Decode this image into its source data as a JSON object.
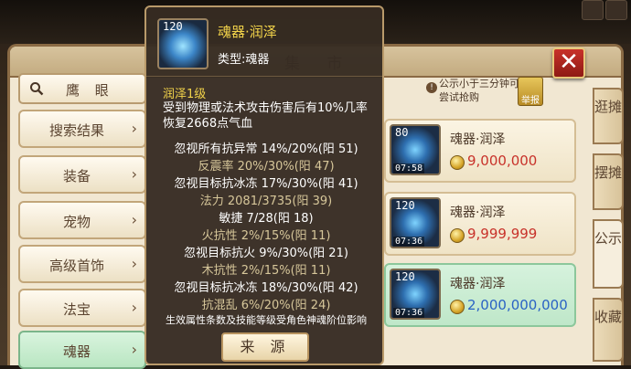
{
  "market": {
    "title": "集 市",
    "close_label": "✕"
  },
  "search": {
    "label": "鹰 眼",
    "icon": "search-icon"
  },
  "menu": [
    {
      "label": "搜索结果",
      "arrow": "›"
    },
    {
      "label": "装备",
      "arrow": "›"
    },
    {
      "label": "宠物",
      "arrow": "›"
    },
    {
      "label": "高级首饰",
      "arrow": "›"
    },
    {
      "label": "法宝",
      "arrow": "›"
    },
    {
      "label": "魂器",
      "arrow": "›"
    }
  ],
  "notice": {
    "icon": "!",
    "text": "公示小于三分钟可尝试抢购",
    "report_label": "举报"
  },
  "side_tabs": [
    {
      "label": "逛摊"
    },
    {
      "label": "摆摊"
    },
    {
      "label": "公示"
    },
    {
      "label": "收藏"
    }
  ],
  "listings": [
    {
      "level": "80",
      "time": "07:58",
      "name": "魂器·润泽",
      "price": "9,000,000",
      "price_color": "#c8322a"
    },
    {
      "level": "120",
      "time": "07:36",
      "name": "魂器·润泽",
      "price": "9,999,999",
      "price_color": "#c8322a"
    },
    {
      "level": "120",
      "time": "07:36",
      "name": "魂器·润泽",
      "price": "2,000,000,000",
      "price_color": "#2a63c4"
    }
  ],
  "tooltip": {
    "level": "120",
    "title": "魂器·润泽",
    "type": "类型:魂器",
    "skill_name": "润泽1级",
    "skill_desc": "受到物理或法术攻击伤害后有10%几率恢复2668点气血",
    "attributes": [
      {
        "text": "忽视所有抗异常 14%/20%(阳 51)",
        "color": "#ffffff"
      },
      {
        "text": "反震率 20%/30%(阳 47)",
        "color": "#d7c79a"
      },
      {
        "text": "忽视目标抗冰冻 17%/30%(阳 41)",
        "color": "#ffffff"
      },
      {
        "text": "法力 2081/3735(阳 39)",
        "color": "#d7c79a"
      },
      {
        "text": "敏捷 7/28(阳 18)",
        "color": "#ffffff"
      },
      {
        "text": "火抗性 2%/15%(阳 11)",
        "color": "#d7c79a"
      },
      {
        "text": "忽视目标抗火 9%/30%(阳 21)",
        "color": "#ffffff"
      },
      {
        "text": "木抗性 2%/15%(阳 11)",
        "color": "#d7c79a"
      },
      {
        "text": "忽视目标抗冰冻 18%/30%(阳 42)",
        "color": "#ffffff"
      },
      {
        "text": "抗混乱 6%/20%(阳 24)",
        "color": "#d7c79a"
      }
    ],
    "footer": "生效属性条数及技能等级受角色神魂阶位影响",
    "source_label": "来 源"
  }
}
